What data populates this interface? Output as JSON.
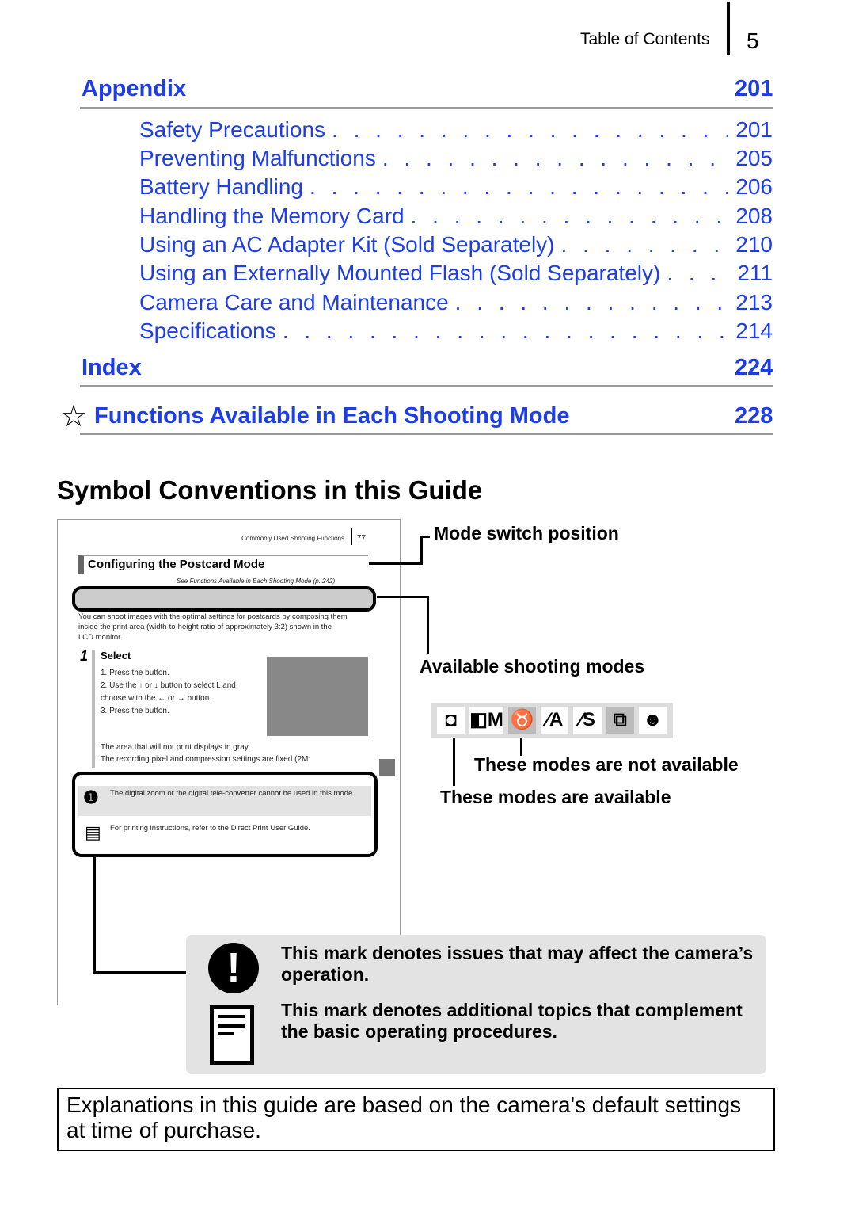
{
  "header": {
    "section": "Table of Contents",
    "page": "5"
  },
  "toc": {
    "appendix": {
      "label": "Appendix",
      "page": "201"
    },
    "items": [
      {
        "label": "Safety Precautions",
        "page": "201"
      },
      {
        "label": "Preventing Malfunctions",
        "page": "205"
      },
      {
        "label": "Battery Handling",
        "page": "206"
      },
      {
        "label": "Handling the Memory Card",
        "page": "208"
      },
      {
        "label": "Using an AC Adapter Kit (Sold Separately)",
        "page": "210"
      },
      {
        "label": "Using an Externally Mounted Flash (Sold Separately)",
        "page": "211"
      },
      {
        "label": "Camera Care and Maintenance",
        "page": "213"
      },
      {
        "label": "Specifications",
        "page": "214"
      }
    ],
    "index": {
      "label": "Index",
      "page": "224"
    },
    "functions": {
      "label": "Functions Available in Each Shooting Mode",
      "page": "228",
      "icon": "star-icon"
    }
  },
  "symbols": {
    "title": "Symbol Conventions in this Guide",
    "sample": {
      "header": "Commonly Used Shooting Functions",
      "page": "77",
      "title": "Configuring the Postcard Mode",
      "ref": "See Functions Available in Each Shooting Mode (p. 242)",
      "intro": "You can shoot images with the optimal settings for postcards by composing them inside the print area (width-to-height ratio of approximately 3:2) shown in the LCD monitor.",
      "step_num": "1",
      "step_title": "Select",
      "steps": [
        "1. Press the button.",
        "2. Use the ↑ or ↓ button to select L and choose with the ← or → button.",
        "3. Press the button."
      ],
      "bullets": [
        "The area that will not print displays in gray.",
        "The recording pixel and compression settings are fixed (2M:"
      ],
      "caution": "The digital zoom or the digital tele-converter cannot be used in this mode.",
      "info": "For printing instructions, refer to the Direct Print User Guide."
    },
    "callouts": {
      "mode_switch": "Mode switch position",
      "available_modes": "Available shooting modes",
      "not_available": "These modes are not available",
      "available": "These modes are available",
      "caution_note": "This mark denotes issues that may affect the camera’s operation.",
      "info_note": "This mark denotes additional topics that complement the basic operating procedures."
    },
    "modes": [
      {
        "icon": "camera-auto-icon",
        "glyph": "◘",
        "available": true
      },
      {
        "icon": "camera-manual-icon",
        "glyph": "◧M",
        "available": true
      },
      {
        "icon": "digital-macro-icon",
        "glyph": "♉",
        "available": false
      },
      {
        "icon": "color-accent-icon",
        "glyph": "⁄A",
        "available": true
      },
      {
        "icon": "color-swap-icon",
        "glyph": "⁄S",
        "available": true
      },
      {
        "icon": "stitch-assist-icon",
        "glyph": "⧉",
        "available": false
      },
      {
        "icon": "portrait-icon",
        "glyph": "☻",
        "available": true
      }
    ]
  },
  "footer": "Explanations in this guide are based on the camera's default settings at time of purchase.",
  "colors": {
    "link": "#1d3de6",
    "rule": "#999999",
    "note_bg": "#e3e3e3"
  }
}
